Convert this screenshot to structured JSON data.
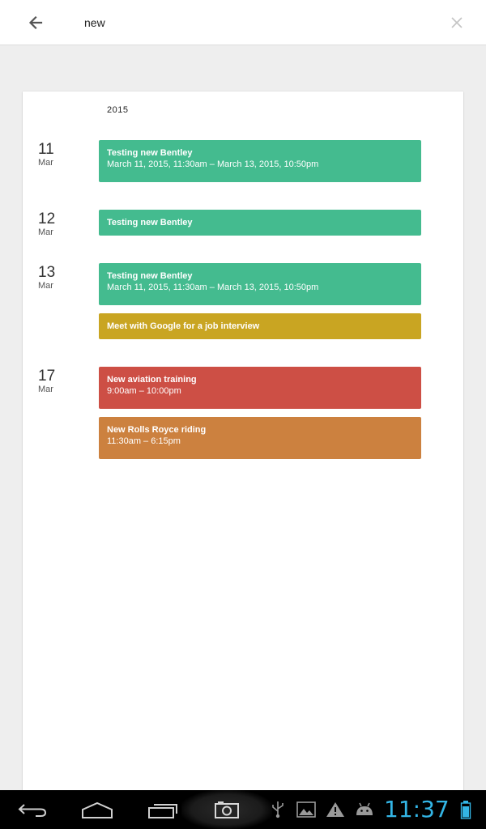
{
  "search": {
    "value": "new",
    "back_icon": "arrow-left-icon",
    "clear_icon": "close-icon"
  },
  "results": {
    "year": "2015",
    "days": [
      {
        "num": "11",
        "month": "Mar",
        "events": [
          {
            "title": "Testing new Bentley",
            "time": "March 11, 2015, 11:30am – March 13, 2015, 10:50pm",
            "color": "#44bb8f"
          }
        ]
      },
      {
        "num": "12",
        "month": "Mar",
        "events": [
          {
            "title": "Testing new Bentley",
            "time": "",
            "color": "#44bb8f"
          }
        ]
      },
      {
        "num": "13",
        "month": "Mar",
        "events": [
          {
            "title": "Testing new Bentley",
            "time": "March 11, 2015, 11:30am – March 13, 2015, 10:50pm",
            "color": "#44bb8f"
          },
          {
            "title": "Meet with Google for a job interview",
            "time": "",
            "color": "#c9a522"
          }
        ]
      },
      {
        "num": "17",
        "month": "Mar",
        "events": [
          {
            "title": "New aviation training",
            "time": "9:00am – 10:00pm",
            "color": "#cd4f45"
          },
          {
            "title": "New Rolls Royce riding",
            "time": "11:30am – 6:15pm",
            "color": "#cc813f"
          }
        ]
      }
    ]
  },
  "navbar": {
    "buttons": [
      "back-icon",
      "home-icon",
      "recent-apps-icon",
      "camera-icon"
    ],
    "notifications": [
      "usb-icon",
      "gallery-icon",
      "warning-icon",
      "android-icon"
    ],
    "clock": "11:37",
    "battery_icon": "battery-icon",
    "accent": "#33b5e5"
  }
}
